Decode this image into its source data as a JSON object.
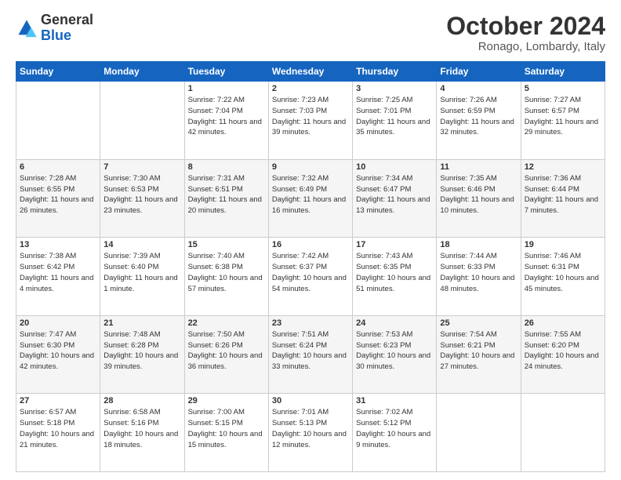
{
  "header": {
    "logo_general": "General",
    "logo_blue": "Blue",
    "month": "October 2024",
    "location": "Ronago, Lombardy, Italy"
  },
  "weekdays": [
    "Sunday",
    "Monday",
    "Tuesday",
    "Wednesday",
    "Thursday",
    "Friday",
    "Saturday"
  ],
  "weeks": [
    [
      {
        "day": "",
        "info": ""
      },
      {
        "day": "",
        "info": ""
      },
      {
        "day": "1",
        "info": "Sunrise: 7:22 AM\nSunset: 7:04 PM\nDaylight: 11 hours and 42 minutes."
      },
      {
        "day": "2",
        "info": "Sunrise: 7:23 AM\nSunset: 7:03 PM\nDaylight: 11 hours and 39 minutes."
      },
      {
        "day": "3",
        "info": "Sunrise: 7:25 AM\nSunset: 7:01 PM\nDaylight: 11 hours and 35 minutes."
      },
      {
        "day": "4",
        "info": "Sunrise: 7:26 AM\nSunset: 6:59 PM\nDaylight: 11 hours and 32 minutes."
      },
      {
        "day": "5",
        "info": "Sunrise: 7:27 AM\nSunset: 6:57 PM\nDaylight: 11 hours and 29 minutes."
      }
    ],
    [
      {
        "day": "6",
        "info": "Sunrise: 7:28 AM\nSunset: 6:55 PM\nDaylight: 11 hours and 26 minutes."
      },
      {
        "day": "7",
        "info": "Sunrise: 7:30 AM\nSunset: 6:53 PM\nDaylight: 11 hours and 23 minutes."
      },
      {
        "day": "8",
        "info": "Sunrise: 7:31 AM\nSunset: 6:51 PM\nDaylight: 11 hours and 20 minutes."
      },
      {
        "day": "9",
        "info": "Sunrise: 7:32 AM\nSunset: 6:49 PM\nDaylight: 11 hours and 16 minutes."
      },
      {
        "day": "10",
        "info": "Sunrise: 7:34 AM\nSunset: 6:47 PM\nDaylight: 11 hours and 13 minutes."
      },
      {
        "day": "11",
        "info": "Sunrise: 7:35 AM\nSunset: 6:46 PM\nDaylight: 11 hours and 10 minutes."
      },
      {
        "day": "12",
        "info": "Sunrise: 7:36 AM\nSunset: 6:44 PM\nDaylight: 11 hours and 7 minutes."
      }
    ],
    [
      {
        "day": "13",
        "info": "Sunrise: 7:38 AM\nSunset: 6:42 PM\nDaylight: 11 hours and 4 minutes."
      },
      {
        "day": "14",
        "info": "Sunrise: 7:39 AM\nSunset: 6:40 PM\nDaylight: 11 hours and 1 minute."
      },
      {
        "day": "15",
        "info": "Sunrise: 7:40 AM\nSunset: 6:38 PM\nDaylight: 10 hours and 57 minutes."
      },
      {
        "day": "16",
        "info": "Sunrise: 7:42 AM\nSunset: 6:37 PM\nDaylight: 10 hours and 54 minutes."
      },
      {
        "day": "17",
        "info": "Sunrise: 7:43 AM\nSunset: 6:35 PM\nDaylight: 10 hours and 51 minutes."
      },
      {
        "day": "18",
        "info": "Sunrise: 7:44 AM\nSunset: 6:33 PM\nDaylight: 10 hours and 48 minutes."
      },
      {
        "day": "19",
        "info": "Sunrise: 7:46 AM\nSunset: 6:31 PM\nDaylight: 10 hours and 45 minutes."
      }
    ],
    [
      {
        "day": "20",
        "info": "Sunrise: 7:47 AM\nSunset: 6:30 PM\nDaylight: 10 hours and 42 minutes."
      },
      {
        "day": "21",
        "info": "Sunrise: 7:48 AM\nSunset: 6:28 PM\nDaylight: 10 hours and 39 minutes."
      },
      {
        "day": "22",
        "info": "Sunrise: 7:50 AM\nSunset: 6:26 PM\nDaylight: 10 hours and 36 minutes."
      },
      {
        "day": "23",
        "info": "Sunrise: 7:51 AM\nSunset: 6:24 PM\nDaylight: 10 hours and 33 minutes."
      },
      {
        "day": "24",
        "info": "Sunrise: 7:53 AM\nSunset: 6:23 PM\nDaylight: 10 hours and 30 minutes."
      },
      {
        "day": "25",
        "info": "Sunrise: 7:54 AM\nSunset: 6:21 PM\nDaylight: 10 hours and 27 minutes."
      },
      {
        "day": "26",
        "info": "Sunrise: 7:55 AM\nSunset: 6:20 PM\nDaylight: 10 hours and 24 minutes."
      }
    ],
    [
      {
        "day": "27",
        "info": "Sunrise: 6:57 AM\nSunset: 5:18 PM\nDaylight: 10 hours and 21 minutes."
      },
      {
        "day": "28",
        "info": "Sunrise: 6:58 AM\nSunset: 5:16 PM\nDaylight: 10 hours and 18 minutes."
      },
      {
        "day": "29",
        "info": "Sunrise: 7:00 AM\nSunset: 5:15 PM\nDaylight: 10 hours and 15 minutes."
      },
      {
        "day": "30",
        "info": "Sunrise: 7:01 AM\nSunset: 5:13 PM\nDaylight: 10 hours and 12 minutes."
      },
      {
        "day": "31",
        "info": "Sunrise: 7:02 AM\nSunset: 5:12 PM\nDaylight: 10 hours and 9 minutes."
      },
      {
        "day": "",
        "info": ""
      },
      {
        "day": "",
        "info": ""
      }
    ]
  ]
}
